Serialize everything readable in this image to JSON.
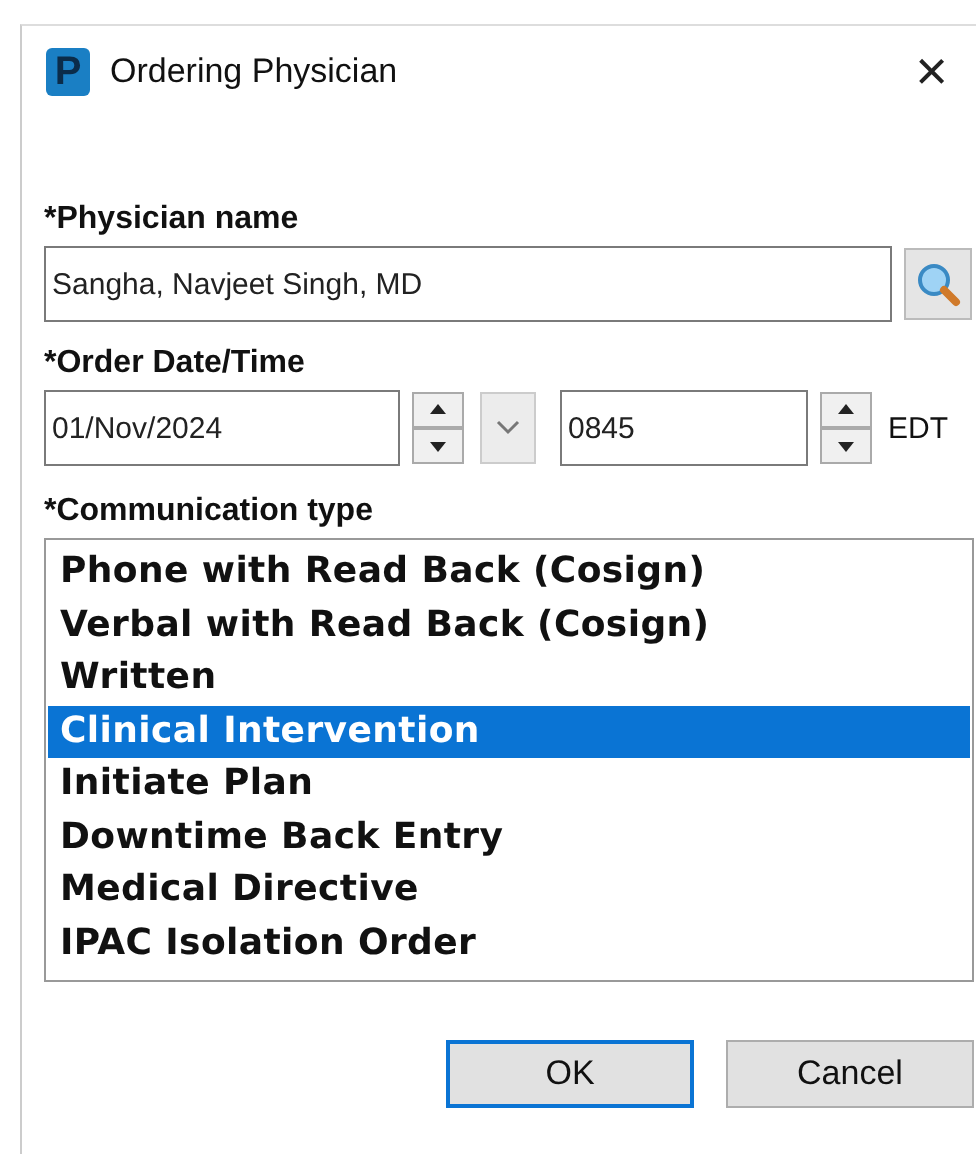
{
  "window": {
    "title": "Ordering Physician",
    "app_icon": "P",
    "close": "×"
  },
  "physician": {
    "label": "*Physician name",
    "value": "Sangha, Navjeet Singh, MD"
  },
  "order_datetime": {
    "label": "*Order Date/Time",
    "date": "01/Nov/2024",
    "time": "0845",
    "timezone": "EDT"
  },
  "communication": {
    "label": "*Communication type",
    "items": [
      {
        "label": "Phone with Read Back (Cosign)",
        "selected": false
      },
      {
        "label": "Verbal with Read Back (Cosign)",
        "selected": false
      },
      {
        "label": "Written",
        "selected": false
      },
      {
        "label": "Clinical Intervention",
        "selected": true
      },
      {
        "label": "Initiate Plan",
        "selected": false
      },
      {
        "label": "Downtime Back Entry",
        "selected": false
      },
      {
        "label": "Medical Directive",
        "selected": false
      },
      {
        "label": "IPAC Isolation Order",
        "selected": false
      }
    ]
  },
  "buttons": [
    {
      "label": "OK",
      "default": true
    },
    {
      "label": "Cancel",
      "default": false
    }
  ]
}
